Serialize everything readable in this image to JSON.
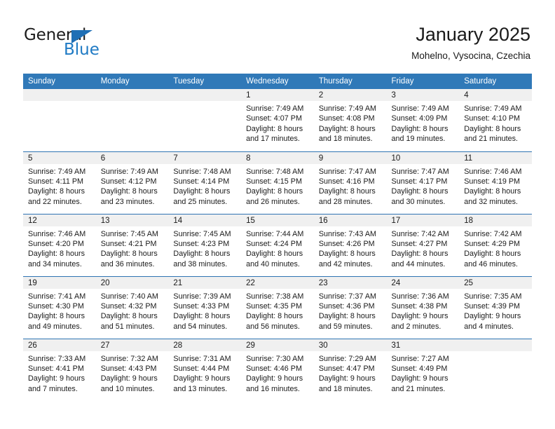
{
  "brand": {
    "name_top": "General",
    "name_bottom": "Blue",
    "accent_color": "#1f7ac4",
    "triangle_icon": "triangle-icon"
  },
  "header": {
    "title": "January 2025",
    "subtitle": "Mohelno, Vysocina, Czechia"
  },
  "theme": {
    "header_bg": "#3079b8",
    "row_divider": "#2f74b3",
    "date_band_bg": "#f0f0f0"
  },
  "weekdays": [
    "Sunday",
    "Monday",
    "Tuesday",
    "Wednesday",
    "Thursday",
    "Friday",
    "Saturday"
  ],
  "labels": {
    "sunrise_prefix": "Sunrise:",
    "sunset_prefix": "Sunset:",
    "daylight_prefix": "Daylight:"
  },
  "weeks": [
    [
      {
        "day": "",
        "empty": true
      },
      {
        "day": "",
        "empty": true
      },
      {
        "day": "",
        "empty": true
      },
      {
        "day": "1",
        "sunrise": "Sunrise: 7:49 AM",
        "sunset": "Sunset: 4:07 PM",
        "daylight_line1": "Daylight: 8 hours",
        "daylight_line2": "and 17 minutes."
      },
      {
        "day": "2",
        "sunrise": "Sunrise: 7:49 AM",
        "sunset": "Sunset: 4:08 PM",
        "daylight_line1": "Daylight: 8 hours",
        "daylight_line2": "and 18 minutes."
      },
      {
        "day": "3",
        "sunrise": "Sunrise: 7:49 AM",
        "sunset": "Sunset: 4:09 PM",
        "daylight_line1": "Daylight: 8 hours",
        "daylight_line2": "and 19 minutes."
      },
      {
        "day": "4",
        "sunrise": "Sunrise: 7:49 AM",
        "sunset": "Sunset: 4:10 PM",
        "daylight_line1": "Daylight: 8 hours",
        "daylight_line2": "and 21 minutes."
      }
    ],
    [
      {
        "day": "5",
        "sunrise": "Sunrise: 7:49 AM",
        "sunset": "Sunset: 4:11 PM",
        "daylight_line1": "Daylight: 8 hours",
        "daylight_line2": "and 22 minutes."
      },
      {
        "day": "6",
        "sunrise": "Sunrise: 7:49 AM",
        "sunset": "Sunset: 4:12 PM",
        "daylight_line1": "Daylight: 8 hours",
        "daylight_line2": "and 23 minutes."
      },
      {
        "day": "7",
        "sunrise": "Sunrise: 7:48 AM",
        "sunset": "Sunset: 4:14 PM",
        "daylight_line1": "Daylight: 8 hours",
        "daylight_line2": "and 25 minutes."
      },
      {
        "day": "8",
        "sunrise": "Sunrise: 7:48 AM",
        "sunset": "Sunset: 4:15 PM",
        "daylight_line1": "Daylight: 8 hours",
        "daylight_line2": "and 26 minutes."
      },
      {
        "day": "9",
        "sunrise": "Sunrise: 7:47 AM",
        "sunset": "Sunset: 4:16 PM",
        "daylight_line1": "Daylight: 8 hours",
        "daylight_line2": "and 28 minutes."
      },
      {
        "day": "10",
        "sunrise": "Sunrise: 7:47 AM",
        "sunset": "Sunset: 4:17 PM",
        "daylight_line1": "Daylight: 8 hours",
        "daylight_line2": "and 30 minutes."
      },
      {
        "day": "11",
        "sunrise": "Sunrise: 7:46 AM",
        "sunset": "Sunset: 4:19 PM",
        "daylight_line1": "Daylight: 8 hours",
        "daylight_line2": "and 32 minutes."
      }
    ],
    [
      {
        "day": "12",
        "sunrise": "Sunrise: 7:46 AM",
        "sunset": "Sunset: 4:20 PM",
        "daylight_line1": "Daylight: 8 hours",
        "daylight_line2": "and 34 minutes."
      },
      {
        "day": "13",
        "sunrise": "Sunrise: 7:45 AM",
        "sunset": "Sunset: 4:21 PM",
        "daylight_line1": "Daylight: 8 hours",
        "daylight_line2": "and 36 minutes."
      },
      {
        "day": "14",
        "sunrise": "Sunrise: 7:45 AM",
        "sunset": "Sunset: 4:23 PM",
        "daylight_line1": "Daylight: 8 hours",
        "daylight_line2": "and 38 minutes."
      },
      {
        "day": "15",
        "sunrise": "Sunrise: 7:44 AM",
        "sunset": "Sunset: 4:24 PM",
        "daylight_line1": "Daylight: 8 hours",
        "daylight_line2": "and 40 minutes."
      },
      {
        "day": "16",
        "sunrise": "Sunrise: 7:43 AM",
        "sunset": "Sunset: 4:26 PM",
        "daylight_line1": "Daylight: 8 hours",
        "daylight_line2": "and 42 minutes."
      },
      {
        "day": "17",
        "sunrise": "Sunrise: 7:42 AM",
        "sunset": "Sunset: 4:27 PM",
        "daylight_line1": "Daylight: 8 hours",
        "daylight_line2": "and 44 minutes."
      },
      {
        "day": "18",
        "sunrise": "Sunrise: 7:42 AM",
        "sunset": "Sunset: 4:29 PM",
        "daylight_line1": "Daylight: 8 hours",
        "daylight_line2": "and 46 minutes."
      }
    ],
    [
      {
        "day": "19",
        "sunrise": "Sunrise: 7:41 AM",
        "sunset": "Sunset: 4:30 PM",
        "daylight_line1": "Daylight: 8 hours",
        "daylight_line2": "and 49 minutes."
      },
      {
        "day": "20",
        "sunrise": "Sunrise: 7:40 AM",
        "sunset": "Sunset: 4:32 PM",
        "daylight_line1": "Daylight: 8 hours",
        "daylight_line2": "and 51 minutes."
      },
      {
        "day": "21",
        "sunrise": "Sunrise: 7:39 AM",
        "sunset": "Sunset: 4:33 PM",
        "daylight_line1": "Daylight: 8 hours",
        "daylight_line2": "and 54 minutes."
      },
      {
        "day": "22",
        "sunrise": "Sunrise: 7:38 AM",
        "sunset": "Sunset: 4:35 PM",
        "daylight_line1": "Daylight: 8 hours",
        "daylight_line2": "and 56 minutes."
      },
      {
        "day": "23",
        "sunrise": "Sunrise: 7:37 AM",
        "sunset": "Sunset: 4:36 PM",
        "daylight_line1": "Daylight: 8 hours",
        "daylight_line2": "and 59 minutes."
      },
      {
        "day": "24",
        "sunrise": "Sunrise: 7:36 AM",
        "sunset": "Sunset: 4:38 PM",
        "daylight_line1": "Daylight: 9 hours",
        "daylight_line2": "and 2 minutes."
      },
      {
        "day": "25",
        "sunrise": "Sunrise: 7:35 AM",
        "sunset": "Sunset: 4:39 PM",
        "daylight_line1": "Daylight: 9 hours",
        "daylight_line2": "and 4 minutes."
      }
    ],
    [
      {
        "day": "26",
        "sunrise": "Sunrise: 7:33 AM",
        "sunset": "Sunset: 4:41 PM",
        "daylight_line1": "Daylight: 9 hours",
        "daylight_line2": "and 7 minutes."
      },
      {
        "day": "27",
        "sunrise": "Sunrise: 7:32 AM",
        "sunset": "Sunset: 4:43 PM",
        "daylight_line1": "Daylight: 9 hours",
        "daylight_line2": "and 10 minutes."
      },
      {
        "day": "28",
        "sunrise": "Sunrise: 7:31 AM",
        "sunset": "Sunset: 4:44 PM",
        "daylight_line1": "Daylight: 9 hours",
        "daylight_line2": "and 13 minutes."
      },
      {
        "day": "29",
        "sunrise": "Sunrise: 7:30 AM",
        "sunset": "Sunset: 4:46 PM",
        "daylight_line1": "Daylight: 9 hours",
        "daylight_line2": "and 16 minutes."
      },
      {
        "day": "30",
        "sunrise": "Sunrise: 7:29 AM",
        "sunset": "Sunset: 4:47 PM",
        "daylight_line1": "Daylight: 9 hours",
        "daylight_line2": "and 18 minutes."
      },
      {
        "day": "31",
        "sunrise": "Sunrise: 7:27 AM",
        "sunset": "Sunset: 4:49 PM",
        "daylight_line1": "Daylight: 9 hours",
        "daylight_line2": "and 21 minutes."
      },
      {
        "day": "",
        "empty": true
      }
    ]
  ]
}
